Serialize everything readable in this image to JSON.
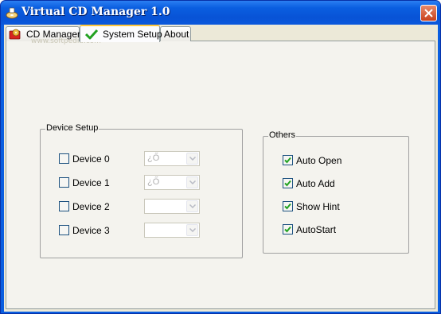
{
  "window": {
    "title": "Virtual CD Manager 1.0",
    "watermark": "www.softpedia.com"
  },
  "tabs": [
    {
      "label": "CD Manager",
      "active": false
    },
    {
      "label": "System Setup",
      "active": true
    },
    {
      "label": "About",
      "active": false
    }
  ],
  "device_setup": {
    "title": "Device Setup",
    "devices": [
      {
        "label": "Device 0",
        "checked": false,
        "value": "¿Ő"
      },
      {
        "label": "Device 1",
        "checked": false,
        "value": "¿Ő"
      },
      {
        "label": "Device 2",
        "checked": false,
        "value": ""
      },
      {
        "label": "Device 3",
        "checked": false,
        "value": ""
      }
    ]
  },
  "others": {
    "title": "Others",
    "options": [
      {
        "label": "Auto Open",
        "checked": true
      },
      {
        "label": "Auto Add",
        "checked": true
      },
      {
        "label": "Show Hint",
        "checked": true
      },
      {
        "label": "AutoStart",
        "checked": true
      }
    ]
  },
  "colors": {
    "titlebar": "#0a5ee0",
    "panel": "#f4f3ee",
    "check_mark": "#21a121",
    "active_tab_highlight": "#ffc73c"
  }
}
